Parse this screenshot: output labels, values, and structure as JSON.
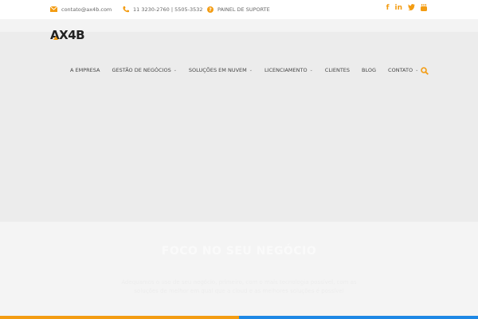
{
  "topbar": {
    "email": "contato@ax4b.com",
    "phone": "11 3230-2760 | 5505-3532",
    "support": "PAINEL DE SUPORTE",
    "social_icons": [
      "facebook-icon",
      "linkedin-icon",
      "twitter-icon",
      "youtube-icon"
    ]
  },
  "logo": {
    "text_main": "AX",
    "text_num": "4",
    "text_end": "B"
  },
  "nav": {
    "items": [
      {
        "label": "A EMPRESA",
        "has_dropdown": false
      },
      {
        "label": "GESTÃO DE NEGÓCIOS",
        "has_dropdown": true
      },
      {
        "label": "SOLUÇÕES EM NUVEM",
        "has_dropdown": true
      },
      {
        "label": "LICENCIAMENTO",
        "has_dropdown": true
      },
      {
        "label": "CLIENTES",
        "has_dropdown": false
      },
      {
        "label": "BLOG",
        "has_dropdown": false
      },
      {
        "label": "CONTATO",
        "has_dropdown": true
      }
    ]
  },
  "hero": {
    "title": "FOCO NO SEU NEGÓCIO",
    "line1": "Adequamos o uso de seu negócio, primeiro, com o mais tecnologia possível, com as",
    "line2": "soluções de melhor em qual que a cloud e as melhores soluções é possível"
  },
  "colors": {
    "accent": "#f39c12",
    "blue": "#1e88e5"
  }
}
